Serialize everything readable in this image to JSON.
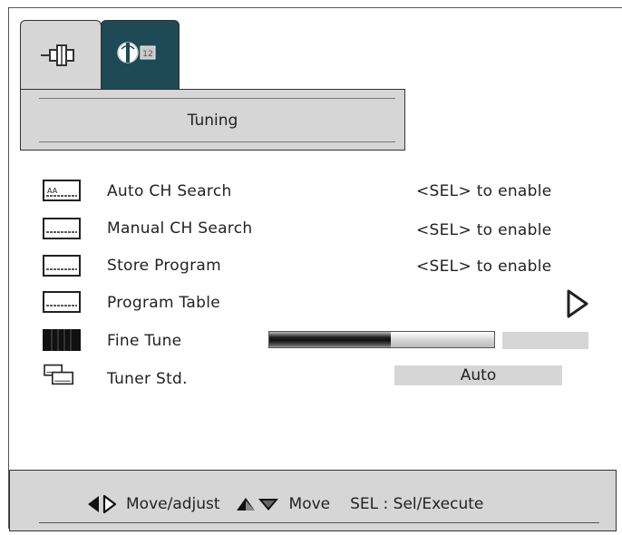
{
  "tabs": [
    {
      "name": "input",
      "icon": "connector-icon",
      "active": false
    },
    {
      "name": "tuning",
      "icon": "antenna-icon",
      "badge": "12",
      "active": true
    }
  ],
  "title": "Tuning",
  "menu": [
    {
      "label": "Auto CH Search",
      "value": "<SEL>  to enable",
      "icon": "auto-search-icon",
      "icon_text": "AA"
    },
    {
      "label": "Manual CH Search",
      "value": "<SEL>  to enable",
      "icon": "manual-search-icon"
    },
    {
      "label": "Store Program",
      "value": "<SEL>  to enable",
      "icon": "store-program-icon"
    },
    {
      "label": "Program Table",
      "value": "",
      "icon": "program-table-icon",
      "submenu_arrow": "right-arrow-icon"
    },
    {
      "label": "Fine Tune",
      "icon": "fine-tune-icon",
      "level": 0.54
    },
    {
      "label": "Tuner Std.",
      "value": "Auto",
      "icon": "tuner-std-icon"
    }
  ],
  "footer": {
    "adjust_label": "Move/adjust",
    "move_label": "Move",
    "sel_label": "SEL : Sel/Execute"
  },
  "colors": {
    "active_tab": "#1d4a55",
    "panel_gray": "#d6d6d6",
    "text": "#222222"
  }
}
